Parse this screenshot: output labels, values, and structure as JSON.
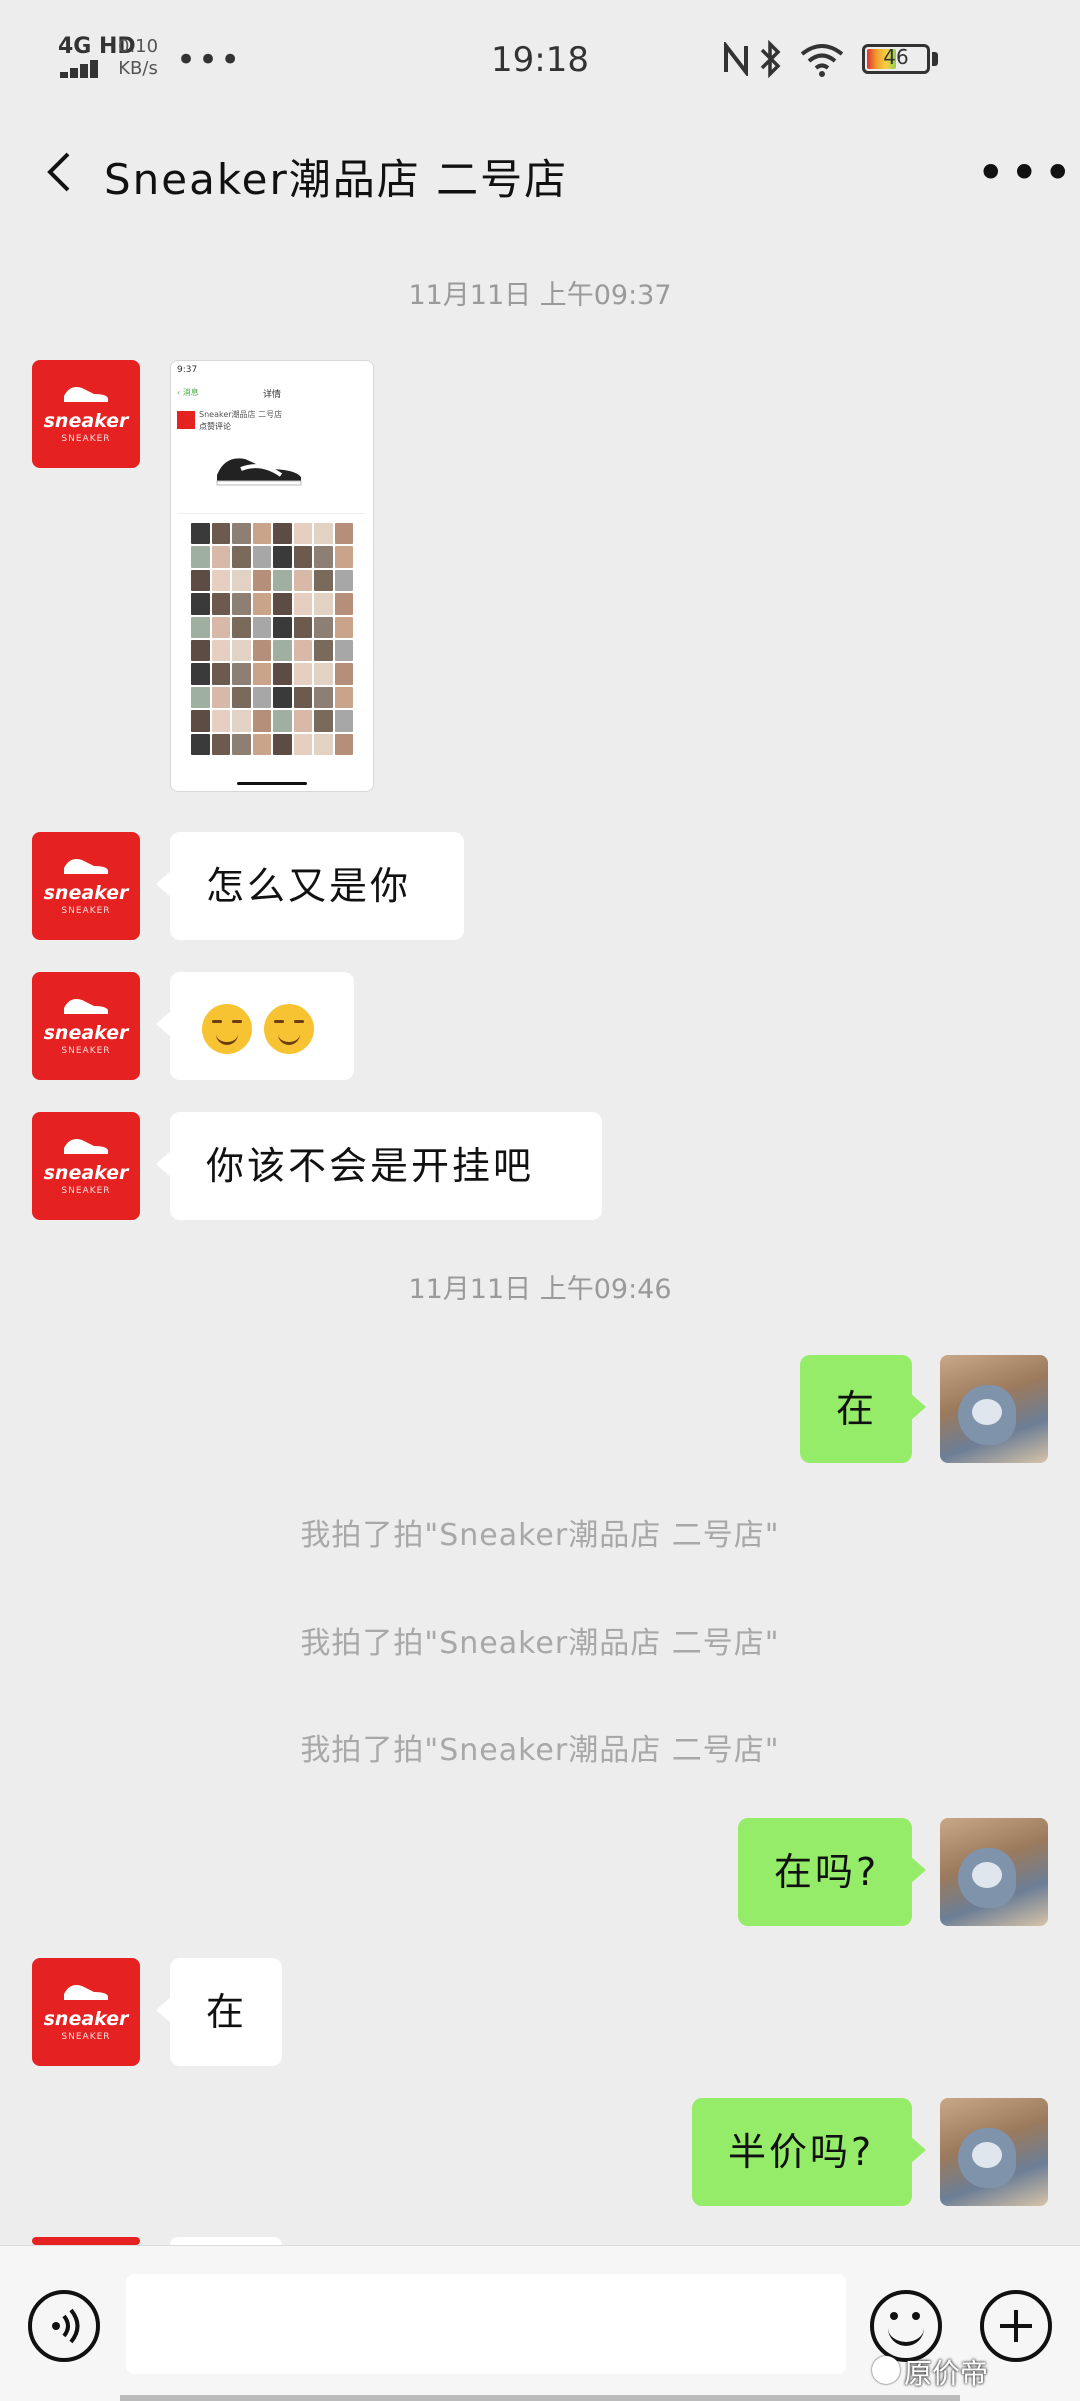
{
  "status_bar": {
    "network": "4G HD",
    "speed": "0.10\nKB/s",
    "time": "19:18",
    "battery": "46"
  },
  "header": {
    "title": "Sneaker潮品店 二号店"
  },
  "messages": {
    "ts1": "11月11日 上午09:37",
    "shop_msg_1": "怎么又是你",
    "shop_msg_3": "你该不会是开挂吧",
    "ts2": "11月11日 上午09:46",
    "me_msg_1": "在",
    "system_1": "我拍了拍\"Sneaker潮品店 二号店\"",
    "system_2": "我拍了拍\"Sneaker潮品店 二号店\"",
    "system_3": "我拍了拍\"Sneaker潮品店 二号店\"",
    "me_msg_2": "在吗?",
    "shop_msg_4": "在",
    "me_msg_3": "半价吗?"
  },
  "shop_avatar": {
    "logo_text": "sneaker"
  },
  "image_message": {
    "time": "9:37",
    "title": "详情",
    "shop_name": "Sneaker潮品店 二号店"
  },
  "watermark": "原价帝",
  "colors": {
    "background": "#ededed",
    "my_bubble": "#95ec69",
    "shop_brand": "#e52121"
  }
}
